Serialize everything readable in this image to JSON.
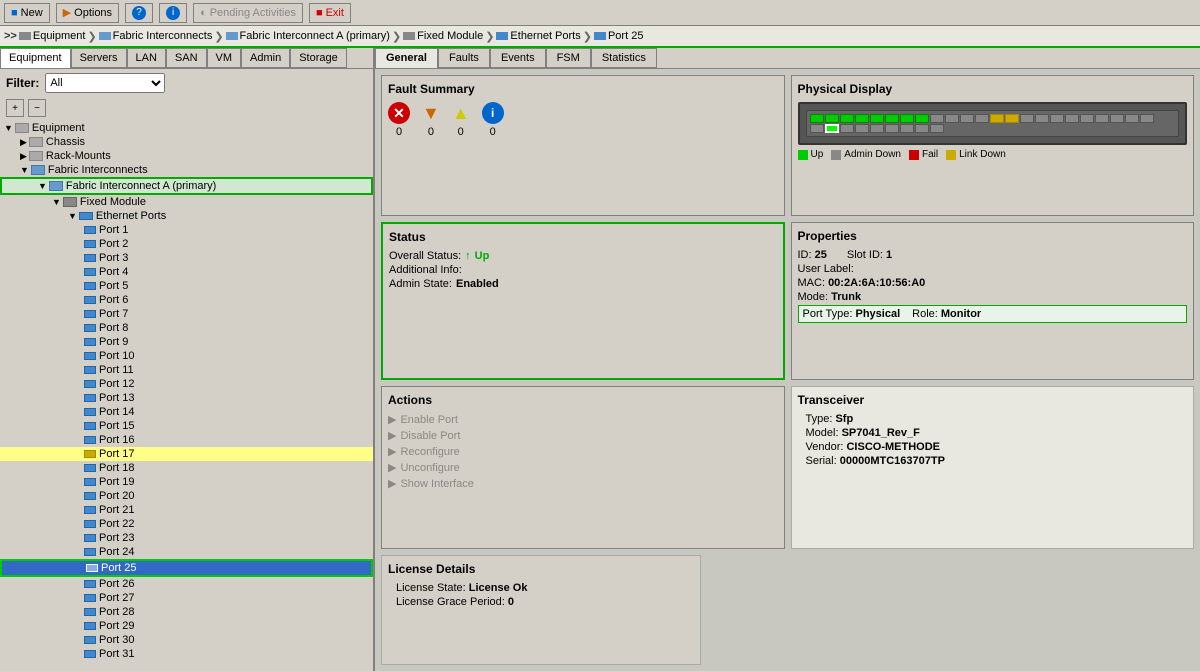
{
  "toolbar": {
    "new_label": "New",
    "options_label": "Options",
    "help_label": "?",
    "info_label": "i",
    "pending_label": "Pending Activities",
    "exit_label": "Exit"
  },
  "breadcrumb": {
    "items": [
      "Equipment",
      "Fabric Interconnects",
      "Fabric Interconnect A (primary)",
      "Fixed Module",
      "Ethernet Ports",
      "Port 25"
    ]
  },
  "left_panel": {
    "tabs": [
      "Equipment",
      "Servers",
      "LAN",
      "SAN",
      "VM",
      "Admin",
      "Storage"
    ],
    "filter_label": "Filter:",
    "filter_value": "All",
    "tree": [
      {
        "label": "Equipment",
        "level": 0,
        "icon": "eq",
        "expanded": true,
        "id": "equipment"
      },
      {
        "label": "Chassis",
        "level": 1,
        "icon": "chassis",
        "expanded": false,
        "id": "chassis"
      },
      {
        "label": "Rack-Mounts",
        "level": 1,
        "icon": "rack",
        "expanded": false,
        "id": "rack"
      },
      {
        "label": "Fabric Interconnects",
        "level": 1,
        "icon": "fi",
        "expanded": true,
        "id": "fabric-interconnects"
      },
      {
        "label": "Fabric Interconnect A (primary)",
        "level": 2,
        "icon": "fi",
        "expanded": true,
        "id": "fi-primary",
        "highlighted": true
      },
      {
        "label": "Fixed Module",
        "level": 3,
        "icon": "module",
        "expanded": true,
        "id": "fixed-module"
      },
      {
        "label": "Ethernet Ports",
        "level": 4,
        "icon": "folder",
        "expanded": true,
        "id": "eth-ports"
      },
      {
        "label": "Port 1",
        "level": 5,
        "icon": "port",
        "id": "port1"
      },
      {
        "label": "Port 2",
        "level": 5,
        "icon": "port",
        "id": "port2"
      },
      {
        "label": "Port 3",
        "level": 5,
        "icon": "port",
        "id": "port3"
      },
      {
        "label": "Port 4",
        "level": 5,
        "icon": "port",
        "id": "port4"
      },
      {
        "label": "Port 5",
        "level": 5,
        "icon": "port",
        "id": "port5"
      },
      {
        "label": "Port 6",
        "level": 5,
        "icon": "port",
        "id": "port6"
      },
      {
        "label": "Port 7",
        "level": 5,
        "icon": "port",
        "id": "port7"
      },
      {
        "label": "Port 8",
        "level": 5,
        "icon": "port",
        "id": "port8"
      },
      {
        "label": "Port 9",
        "level": 5,
        "icon": "port",
        "id": "port9"
      },
      {
        "label": "Port 10",
        "level": 5,
        "icon": "port",
        "id": "port10"
      },
      {
        "label": "Port 11",
        "level": 5,
        "icon": "port",
        "id": "port11"
      },
      {
        "label": "Port 12",
        "level": 5,
        "icon": "port",
        "id": "port12"
      },
      {
        "label": "Port 13",
        "level": 5,
        "icon": "port",
        "id": "port13"
      },
      {
        "label": "Port 14",
        "level": 5,
        "icon": "port",
        "id": "port14"
      },
      {
        "label": "Port 15",
        "level": 5,
        "icon": "port",
        "id": "port15"
      },
      {
        "label": "Port 16",
        "level": 5,
        "icon": "port",
        "id": "port16"
      },
      {
        "label": "Port 17",
        "level": 5,
        "icon": "port",
        "id": "port17",
        "warning": true
      },
      {
        "label": "Port 18",
        "level": 5,
        "icon": "port",
        "id": "port18"
      },
      {
        "label": "Port 19",
        "level": 5,
        "icon": "port",
        "id": "port19"
      },
      {
        "label": "Port 20",
        "level": 5,
        "icon": "port",
        "id": "port20"
      },
      {
        "label": "Port 21",
        "level": 5,
        "icon": "port",
        "id": "port21"
      },
      {
        "label": "Port 22",
        "level": 5,
        "icon": "port",
        "id": "port22"
      },
      {
        "label": "Port 23",
        "level": 5,
        "icon": "port",
        "id": "port23"
      },
      {
        "label": "Port 24",
        "level": 5,
        "icon": "port",
        "id": "port24"
      },
      {
        "label": "Port 25",
        "level": 5,
        "icon": "port",
        "id": "port25",
        "selected": true
      },
      {
        "label": "Port 26",
        "level": 5,
        "icon": "port",
        "id": "port26"
      },
      {
        "label": "Port 27",
        "level": 5,
        "icon": "port",
        "id": "port27"
      },
      {
        "label": "Port 28",
        "level": 5,
        "icon": "port",
        "id": "port28"
      },
      {
        "label": "Port 29",
        "level": 5,
        "icon": "port",
        "id": "port29"
      },
      {
        "label": "Port 30",
        "level": 5,
        "icon": "port",
        "id": "port30"
      },
      {
        "label": "Port 31",
        "level": 5,
        "icon": "port",
        "id": "port31"
      }
    ]
  },
  "right_tabs": [
    "General",
    "Faults",
    "Events",
    "FSM",
    "Statistics"
  ],
  "fault_summary": {
    "title": "Fault Summary",
    "items": [
      {
        "type": "error",
        "count": "0"
      },
      {
        "type": "warning",
        "count": "0"
      },
      {
        "type": "minor",
        "count": "0"
      },
      {
        "type": "info",
        "count": "0"
      }
    ]
  },
  "status": {
    "title": "Status",
    "overall_label": "Overall Status:",
    "overall_value": "Up",
    "additional_label": "Additional Info:",
    "admin_label": "Admin State:",
    "admin_value": "Enabled"
  },
  "actions": {
    "title": "Actions",
    "items": [
      "Enable Port",
      "Disable Port",
      "Reconfigure",
      "Unconfigure",
      "Show Interface"
    ]
  },
  "physical_display": {
    "title": "Physical Display",
    "legend": [
      {
        "color": "#00cc00",
        "label": "Up"
      },
      {
        "color": "#888888",
        "label": "Admin Down"
      },
      {
        "color": "#cc0000",
        "label": "Fail"
      },
      {
        "color": "#ccaa00",
        "label": "Link Down"
      }
    ]
  },
  "properties": {
    "title": "Properties",
    "id": "25",
    "slot_id": "1",
    "user_label": "",
    "mac": "00:2A:6A:10:56:A0",
    "mode": "Trunk",
    "port_type": "Physical",
    "role": "Monitor"
  },
  "transceiver": {
    "title": "Transceiver",
    "type": "Sfp",
    "model": "SP7041_Rev_F",
    "vendor": "CISCO-METHODE",
    "serial": "00000MTC163707TP"
  },
  "license": {
    "title": "License Details",
    "state_label": "License State:",
    "state_value": "License Ok",
    "grace_label": "License Grace Period:",
    "grace_value": "0"
  }
}
